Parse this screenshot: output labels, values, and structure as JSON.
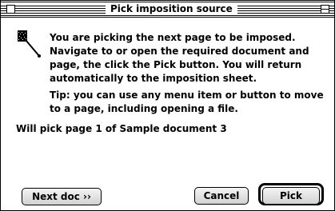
{
  "window": {
    "title": "Pick imposition source"
  },
  "message": {
    "instructions": "You are picking the next page to be imposed. Navigate to or open the required document and page, the click the Pick button. You will return automatically to the imposition sheet.",
    "tip": "Tip: you can use any menu item or button to move to a page, including opening a file.",
    "status": "Will pick page 1 of Sample document 3"
  },
  "icons": {
    "pick": "pick-pin-icon"
  },
  "buttons": {
    "next_doc": "Next doc ››",
    "cancel": "Cancel",
    "pick": "Pick"
  }
}
